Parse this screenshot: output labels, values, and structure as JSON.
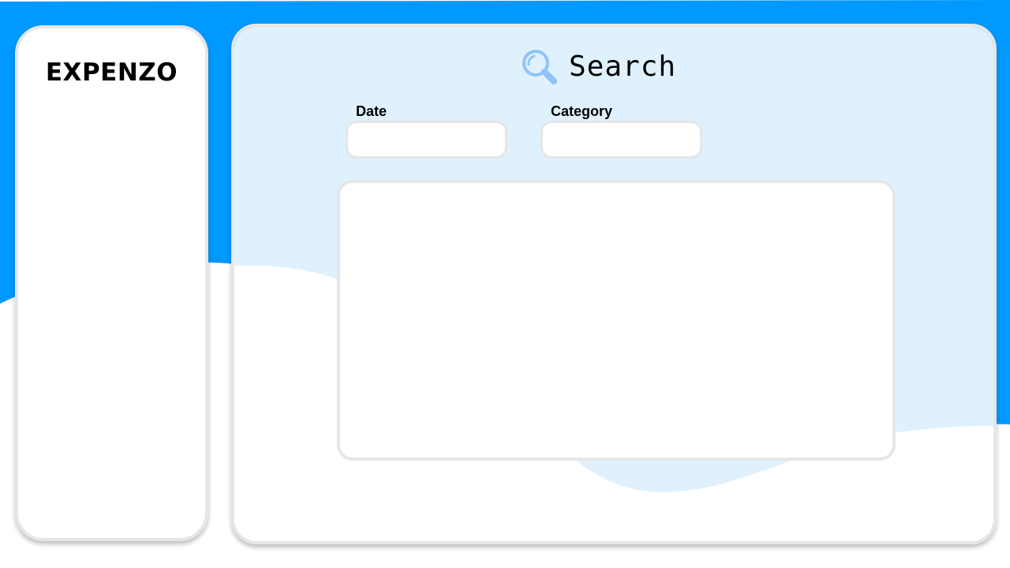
{
  "app": {
    "brand": "EXPENZO"
  },
  "search": {
    "title": "Search",
    "icon": "search-icon",
    "fields": {
      "date": {
        "label": "Date",
        "value": ""
      },
      "category": {
        "label": "Category",
        "value": ""
      }
    },
    "results": []
  },
  "colors": {
    "accent": "#0099ff",
    "panel_tint": "#e0f1fe",
    "border": "#e6e6e6",
    "icon": "#8ec3f7"
  }
}
